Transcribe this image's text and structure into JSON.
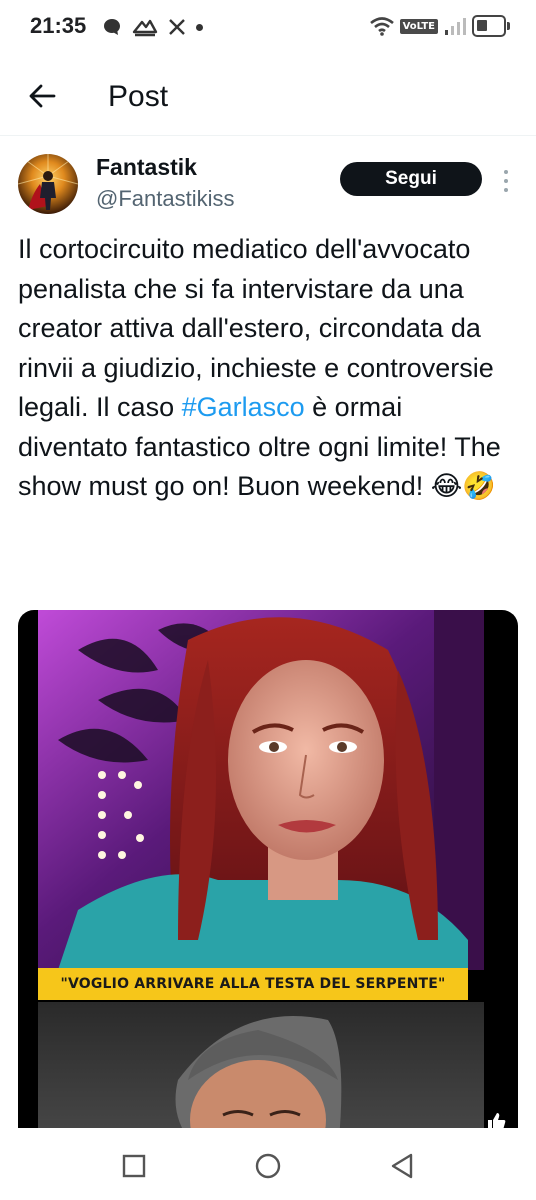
{
  "status_bar": {
    "time": "21:35",
    "left_icons": [
      "chat-bubble-icon",
      "cloud-sync-icon",
      "x-logo-icon",
      "dot-icon"
    ],
    "volte_label": "VoLTE",
    "right_icons": [
      "wifi-icon",
      "volte-icon",
      "signal-icon",
      "battery-icon"
    ]
  },
  "header": {
    "title": "Post",
    "back_icon": "arrow-left-icon"
  },
  "post": {
    "author": {
      "display_name": "Fantastik",
      "handle": "@Fantastikiss"
    },
    "follow_label": "Segui",
    "text_before_hashtag": "Il cortocircuito mediatico dell'avvocato penalista che si fa intervistare da una creator attiva dall'estero, circondata da rinvii a giudizio, inchieste e controversie legali. Il caso ",
    "hashtag": "#Garlasco",
    "text_after_hashtag": " è ormai diventato fantastico oltre ogni limite! The show must go on! Buon weekend! 😂🤣",
    "media": {
      "caption": "\"VOGLIO ARRIVARE ALLA TESTA DEL SERPENTE\""
    }
  },
  "colors": {
    "accent": "#1d9bf0",
    "text": "#0f1419",
    "secondary": "#536471",
    "caption_bg": "#f6c61a"
  },
  "nav_bar": {
    "icons": [
      "recents-square-icon",
      "home-circle-icon",
      "back-triangle-icon"
    ]
  }
}
